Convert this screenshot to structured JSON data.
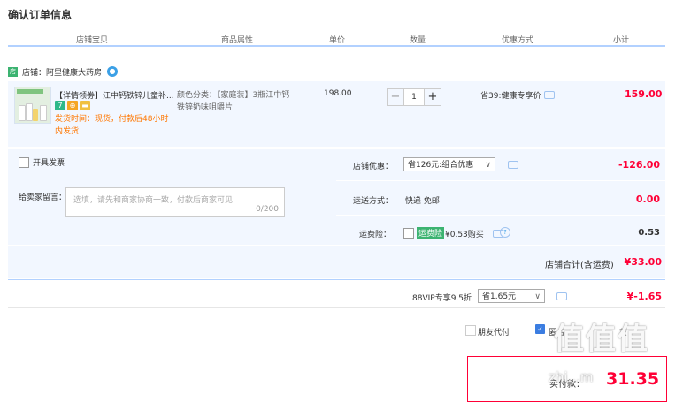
{
  "page": {
    "title": "确认订单信息"
  },
  "columns": [
    "店铺宝贝",
    "商品属性",
    "单价",
    "数量",
    "优惠方式",
    "小计"
  ],
  "store": {
    "tag": "店",
    "label": "店铺：阿里健康大药房",
    "chat_icon": "wangwang-chat-icon"
  },
  "item": {
    "name": "【详情领劵】江中钙铁锌儿童补...",
    "badges": [
      "7",
      "⊕",
      "▬"
    ],
    "shipping_line1": "发货时间：现货，付款后48小时",
    "shipping_line2": "内发货",
    "attr_line1": "颜色分类：【家庭装】3瓶江中钙",
    "attr_line2": "铁锌奶味咀嚼片",
    "unit_price": "198.00",
    "quantity": "1",
    "minus": "−",
    "plus": "+",
    "promo": "省39:健康专享价",
    "subtotal": "159.00"
  },
  "invoice": {
    "label": "开具发票"
  },
  "message": {
    "label": "给卖家留言：",
    "placeholder": "选填，请先和商家协商一致，付款后商家可见",
    "counter": "0/200"
  },
  "store_discount": {
    "label": "店铺优惠：",
    "selected": "省126元:组合优惠",
    "amount": "-126.00"
  },
  "delivery": {
    "label": "运送方式：",
    "method": "快递 免邮",
    "amount": "0.00"
  },
  "insurance": {
    "label": "运费险：",
    "badge": "运费险",
    "text": "¥0.53购买",
    "amount": "0.53"
  },
  "store_total": {
    "label": "店铺合计(含运费)",
    "amount": "¥33.00"
  },
  "vip": {
    "label": "88VIP专享9.5折",
    "selected": "省1.65元",
    "amount": "¥-1.65"
  },
  "options": {
    "friend_pay": "朋友代付",
    "anonymous": "匿名",
    "other": "蒙"
  },
  "payment": {
    "label": "实付款：",
    "amount": "31.35"
  },
  "watermark": {
    "logo": "值值值",
    "site": "zhi...m"
  },
  "colors": {
    "accent_red": "#ff0036",
    "header_line": "#b2d1ff",
    "panel_bg": "#f2f7ff",
    "ship_orange": "#ff7700"
  }
}
